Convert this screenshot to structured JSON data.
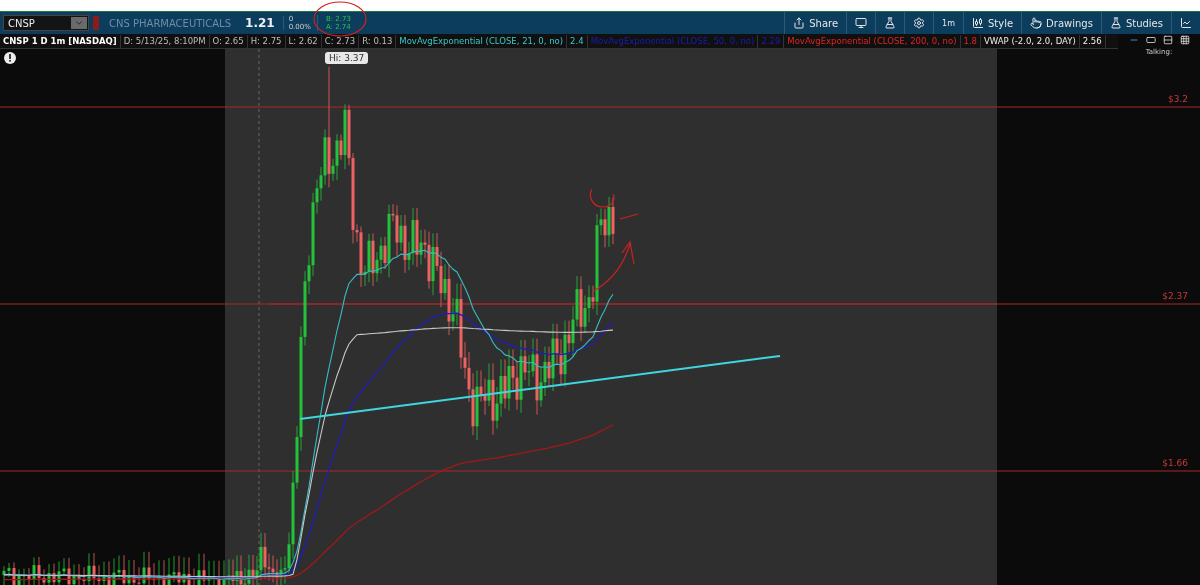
{
  "header": {
    "symbol": "CNSP",
    "company": "CNS PHARMACEUTICALS",
    "last": "1.21",
    "change": "0",
    "change_percent": "0.00%",
    "bid": "B: 2.73",
    "ask": "A: 2.74"
  },
  "toolbar": [
    {
      "kind": "share",
      "label": "Share"
    },
    {
      "kind": "screen"
    },
    {
      "kind": "flask"
    },
    {
      "kind": "settings"
    },
    {
      "kind": "interval",
      "label": "1m"
    },
    {
      "kind": "style",
      "label": "Style"
    },
    {
      "kind": "drawings",
      "label": "Drawings"
    },
    {
      "kind": "studies",
      "label": "Studies"
    },
    {
      "kind": "chart"
    }
  ],
  "study_bar": [
    {
      "text": "CNSP 1 D 1m [NASDAQ]",
      "kind": "title"
    },
    {
      "text": "D: 5/13/25, 8:10PM",
      "kind": "quote"
    },
    {
      "text": "O: 2.65",
      "kind": "quote"
    },
    {
      "text": "H: 2.75",
      "kind": "quote"
    },
    {
      "text": "L: 2.62",
      "kind": "quote"
    },
    {
      "text": "C: 2.73",
      "kind": "quote"
    },
    {
      "text": "R: 0.13",
      "kind": "quote"
    },
    {
      "text": "MovAvgExponential (CLOSE, 21, 0, no)",
      "kind": "ema21"
    },
    {
      "text": "2.4",
      "kind": "ema21"
    },
    {
      "text": "MovAvgExponential (CLOSE, 50, 0, no)",
      "kind": "ema50"
    },
    {
      "text": "2.29",
      "kind": "ema50"
    },
    {
      "text": "MovAvgExponential (CLOSE, 200, 0, no)",
      "kind": "ema200"
    },
    {
      "text": "1.8",
      "kind": "ema200"
    },
    {
      "text": "VWAP (-2.0, 2.0, DAY)",
      "kind": "vwap"
    },
    {
      "text": "2.56",
      "kind": "vwap"
    }
  ],
  "chart": {
    "high_label": "Hi: 3.37",
    "levels": [
      {
        "label": "$3.2"
      },
      {
        "label": "$2.37"
      },
      {
        "label": "$1.66"
      }
    ]
  },
  "side_panel": {
    "label": "Talking:"
  }
}
